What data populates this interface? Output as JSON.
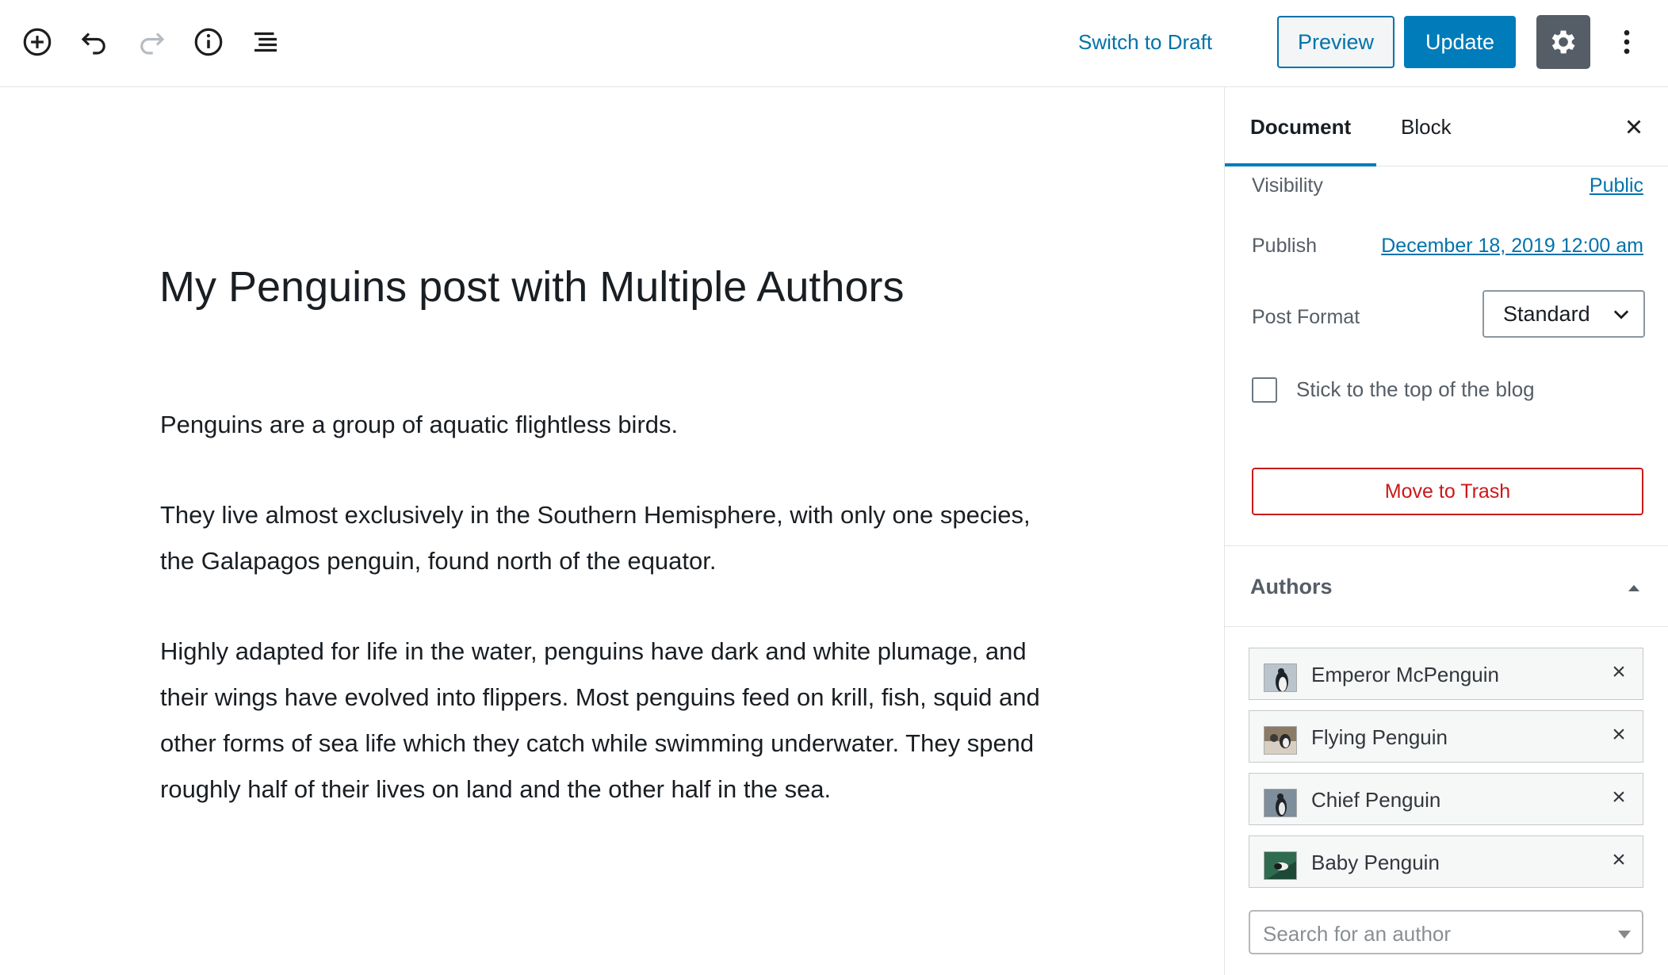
{
  "toolbar": {
    "icons": [
      "add-block-icon",
      "undo-icon",
      "redo-icon",
      "info-icon",
      "block-navigation-icon"
    ],
    "switch_to_draft": "Switch to Draft",
    "preview": "Preview",
    "update": "Update",
    "settings_icon": "gear-icon",
    "more_icon": "more-vertical-icon"
  },
  "editor": {
    "title": "My Penguins post with Multiple Authors",
    "paragraphs": [
      "Penguins are a group of aquatic flightless birds.",
      "They live almost exclusively in the Southern Hemisphere, with only one species, the Galapagos penguin, found north of the equator.",
      "Highly adapted for life in the water, penguins have dark and white plumage, and their wings have evolved into flippers. Most penguins feed on krill, fish, squid and other forms of sea life which they catch while swimming underwater. They spend roughly half of their lives on land and the other half in the sea."
    ]
  },
  "sidebar": {
    "tabs": [
      "Document",
      "Block"
    ],
    "visibility": {
      "label": "Visibility",
      "value": "Public"
    },
    "publish": {
      "label": "Publish",
      "value": "December 18, 2019 12:00 am"
    },
    "post_format": {
      "label": "Post Format",
      "value": "Standard"
    },
    "sticky": {
      "label": "Stick to the top of the blog",
      "checked": false
    },
    "trash": "Move to Trash",
    "authors": {
      "title": "Authors",
      "list": [
        {
          "name": "Emperor McPenguin"
        },
        {
          "name": "Flying Penguin"
        },
        {
          "name": "Chief Penguin"
        },
        {
          "name": "Baby Penguin"
        }
      ],
      "remove_symbol": "×",
      "search_placeholder": "Search for an author"
    }
  },
  "colors": {
    "accent": "#007cba",
    "link": "#0073aa",
    "danger": "#cc1818",
    "settings_bg": "#555d66"
  }
}
